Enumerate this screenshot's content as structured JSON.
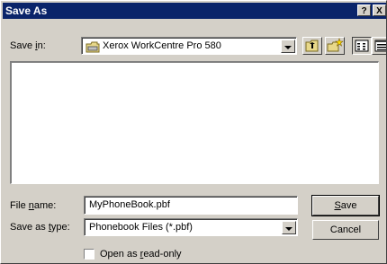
{
  "window": {
    "title": "Save As",
    "help_label": "?",
    "close_label": "X"
  },
  "save_in": {
    "label_pre": "Save ",
    "label_key": "i",
    "label_post": "n:",
    "value": "Xerox WorkCentre Pro 580"
  },
  "toolbar": [
    {
      "name": "up-one-level-icon"
    },
    {
      "name": "create-new-folder-icon"
    },
    {
      "name": "list-view-icon"
    },
    {
      "name": "details-view-icon"
    }
  ],
  "file_name": {
    "label_pre": "File ",
    "label_key": "n",
    "label_post": "ame:",
    "value": "MyPhoneBook.pbf"
  },
  "save_type": {
    "label_pre": "Save as ",
    "label_key": "t",
    "label_post": "ype:",
    "value": "Phonebook Files (*.pbf)"
  },
  "buttons": {
    "save_key": "S",
    "save_rest": "ave",
    "cancel": "Cancel"
  },
  "readonly": {
    "label_pre": "Open as ",
    "label_key": "r",
    "label_post": "ead-only",
    "checked": false
  }
}
